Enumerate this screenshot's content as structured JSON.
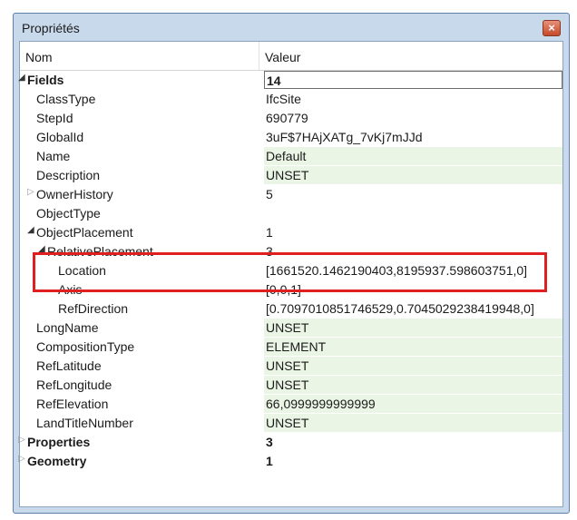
{
  "window": {
    "title": "Propriétés",
    "close_glyph": "×"
  },
  "grid": {
    "col_name": "Nom",
    "col_value": "Valeur",
    "rows": [
      {
        "name": "Fields",
        "value": "14",
        "level": 0,
        "expander": "expanded",
        "bold": true,
        "value_style": "boxed"
      },
      {
        "name": "ClassType",
        "value": "IfcSite",
        "level": 1,
        "expander": "none",
        "bold": false,
        "value_style": "plain"
      },
      {
        "name": "StepId",
        "value": "690779",
        "level": 1,
        "expander": "none",
        "bold": false,
        "value_style": "plain"
      },
      {
        "name": "GlobalId",
        "value": "3uF$7HAjXATg_7vKj7mJJd",
        "level": 1,
        "expander": "none",
        "bold": false,
        "value_style": "plain"
      },
      {
        "name": "Name",
        "value": "Default",
        "level": 1,
        "expander": "none",
        "bold": false,
        "value_style": "green"
      },
      {
        "name": "Description",
        "value": "UNSET",
        "level": 1,
        "expander": "none",
        "bold": false,
        "value_style": "green"
      },
      {
        "name": "OwnerHistory",
        "value": "5",
        "level": 1,
        "expander": "collapsed",
        "bold": false,
        "value_style": "plain"
      },
      {
        "name": "ObjectType",
        "value": "",
        "level": 1,
        "expander": "none",
        "bold": false,
        "value_style": "plain"
      },
      {
        "name": "ObjectPlacement",
        "value": "1",
        "level": 1,
        "expander": "expanded",
        "bold": false,
        "value_style": "plain"
      },
      {
        "name": "RelativePlacement",
        "value": "3",
        "level": 2,
        "expander": "expanded",
        "bold": false,
        "value_style": "plain"
      },
      {
        "name": "Location",
        "value": "[1661520.1462190403,8195937.598603751,0]",
        "level": 3,
        "expander": "none",
        "bold": false,
        "value_style": "plain"
      },
      {
        "name": "Axis",
        "value": "[0,0,1]",
        "level": 3,
        "expander": "none",
        "bold": false,
        "value_style": "plain"
      },
      {
        "name": "RefDirection",
        "value": "[0.7097010851746529,0.7045029238419948,0]",
        "level": 3,
        "expander": "none",
        "bold": false,
        "value_style": "plain"
      },
      {
        "name": "LongName",
        "value": "UNSET",
        "level": 1,
        "expander": "none",
        "bold": false,
        "value_style": "green"
      },
      {
        "name": "CompositionType",
        "value": "ELEMENT",
        "level": 1,
        "expander": "none",
        "bold": false,
        "value_style": "green"
      },
      {
        "name": "RefLatitude",
        "value": "UNSET",
        "level": 1,
        "expander": "none",
        "bold": false,
        "value_style": "green"
      },
      {
        "name": "RefLongitude",
        "value": "UNSET",
        "level": 1,
        "expander": "none",
        "bold": false,
        "value_style": "green"
      },
      {
        "name": "RefElevation",
        "value": "66,0999999999999",
        "level": 1,
        "expander": "none",
        "bold": false,
        "value_style": "green"
      },
      {
        "name": "LandTitleNumber",
        "value": "UNSET",
        "level": 1,
        "expander": "none",
        "bold": false,
        "value_style": "green"
      },
      {
        "name": "Properties",
        "value": "3",
        "level": 0,
        "expander": "collapsed",
        "bold": true,
        "value_style": "plain"
      },
      {
        "name": "Geometry",
        "value": "1",
        "level": 0,
        "expander": "collapsed",
        "bold": true,
        "value_style": "plain"
      }
    ]
  },
  "colors": {
    "highlight_border": "#e02020",
    "editable_value_bg": "#eaf5e5",
    "window_frame": "#c9d9ec"
  }
}
